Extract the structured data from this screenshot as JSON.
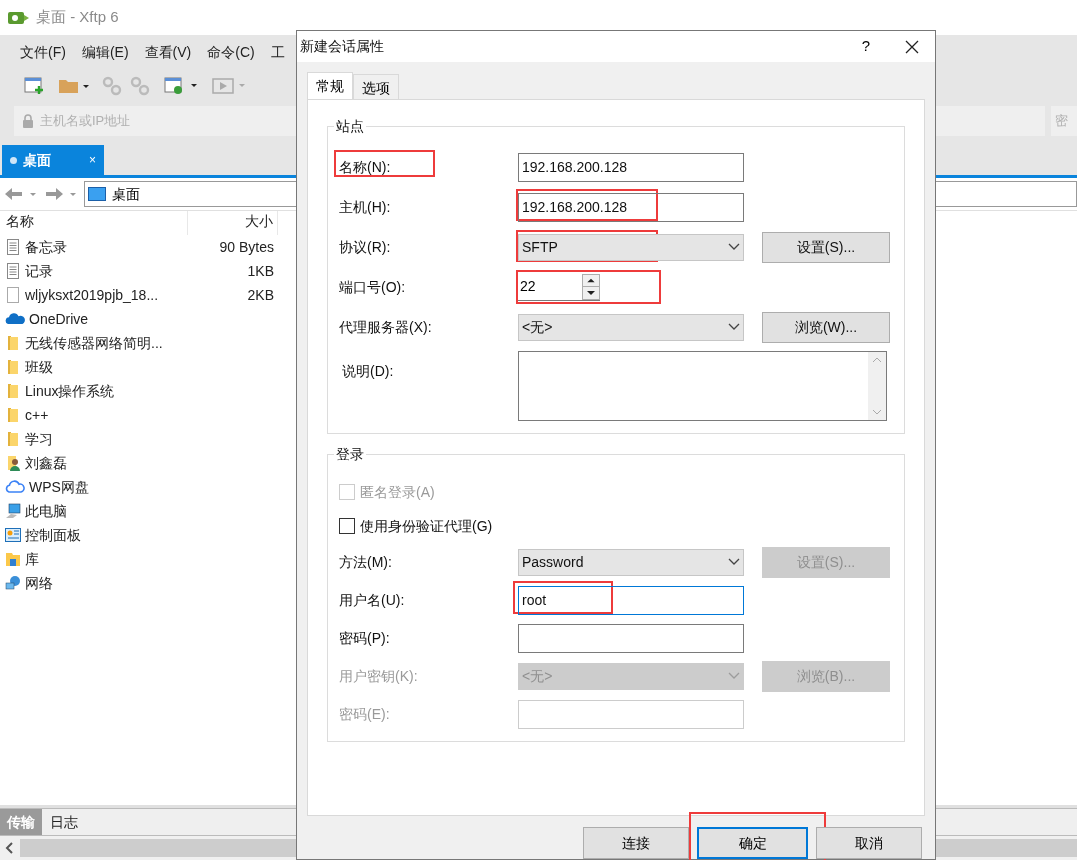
{
  "app": {
    "title": "桌面 - Xftp 6",
    "menu": [
      "文件(F)",
      "编辑(E)",
      "查看(V)",
      "命令(C)",
      "工"
    ],
    "address_placeholder": "主机名或IP地址",
    "address_right_label": "密",
    "tabs": [
      {
        "label": "桌面",
        "selected": true,
        "close": "×"
      }
    ],
    "path": "桌面",
    "columns": [
      "名称",
      "大小"
    ],
    "files": [
      {
        "kind": "text",
        "name": "备忘录",
        "size": "90 Bytes"
      },
      {
        "kind": "text",
        "name": "记录",
        "size": "1KB"
      },
      {
        "kind": "file",
        "name": "wljyksxt2019pjb_18...",
        "size": "2KB"
      },
      {
        "kind": "onedrive",
        "name": "OneDrive"
      },
      {
        "kind": "folder",
        "name": "无线传感器网络简明..."
      },
      {
        "kind": "folder",
        "name": "班级"
      },
      {
        "kind": "folder",
        "name": "Linux操作系统"
      },
      {
        "kind": "folder",
        "name": "c++"
      },
      {
        "kind": "folder",
        "name": "学习"
      },
      {
        "kind": "user",
        "name": "刘鑫磊"
      },
      {
        "kind": "cloud",
        "name": "WPS网盘"
      },
      {
        "kind": "computer",
        "name": "此电脑"
      },
      {
        "kind": "control-panel",
        "name": "控制面板"
      },
      {
        "kind": "library",
        "name": "库"
      },
      {
        "kind": "network",
        "name": "网络"
      }
    ],
    "bottom_tabs": [
      {
        "label": "传输",
        "selected": true
      },
      {
        "label": "日志",
        "selected": false
      }
    ]
  },
  "dialog": {
    "title": "新建会话属性",
    "help": "?",
    "tabs": [
      {
        "label": "常规",
        "selected": true
      },
      {
        "label": "选项",
        "selected": false
      }
    ],
    "groups": [
      {
        "title": "站点",
        "rows": [
          {
            "kind": "text",
            "label": "名称(N):",
            "value": "192.168.200.128",
            "label_annotated": true
          },
          {
            "kind": "text",
            "label": "主机(H):",
            "value": "192.168.200.128",
            "field_annotated": true
          },
          {
            "kind": "select",
            "label": "协议(R):",
            "value": "SFTP",
            "field_annotated": true,
            "button": {
              "label": "设置(S)...",
              "disabled": false
            }
          },
          {
            "kind": "spin",
            "label": "端口号(O):",
            "value": "22",
            "field_annotated": true
          },
          {
            "kind": "select",
            "label": "代理服务器(X):",
            "value": "<无>",
            "button": {
              "label": "浏览(W)...",
              "disabled": false
            }
          },
          {
            "kind": "textarea",
            "label": "说明(D):"
          }
        ]
      },
      {
        "title": "登录",
        "rows": [
          {
            "kind": "checkbox",
            "label": "匿名登录(A)",
            "checked": false,
            "disabled": true
          },
          {
            "kind": "checkbox",
            "label": "使用身份验证代理(G)",
            "checked": false,
            "disabled": false
          },
          {
            "kind": "select",
            "label": "方法(M):",
            "value": "Password",
            "button": {
              "label": "设置(S)...",
              "disabled": true
            }
          },
          {
            "kind": "text",
            "label": "用户名(U):",
            "value": "root",
            "focused": true,
            "field_annotated": true
          },
          {
            "kind": "text",
            "label": "密码(P):"
          },
          {
            "kind": "select",
            "label": "用户密钥(K):",
            "value": "<无>",
            "disabled": true,
            "button": {
              "label": "浏览(B)...",
              "disabled": true
            }
          },
          {
            "kind": "text",
            "label": "密码(E):",
            "disabled": true
          }
        ]
      }
    ],
    "buttons": [
      {
        "label": "连接",
        "default": false
      },
      {
        "label": "确定",
        "default": true,
        "annotated": true
      },
      {
        "label": "取消",
        "default": false
      }
    ]
  }
}
